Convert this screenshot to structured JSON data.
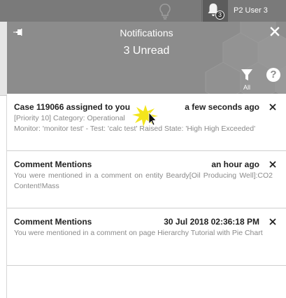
{
  "topbar": {
    "user_name": "P2 User 3",
    "notification_count": "3",
    "icons": [
      "lightbulb-icon",
      "bell-icon"
    ]
  },
  "panel": {
    "title": "Notifications",
    "unread_summary": "3 Unread",
    "filter_label": "All",
    "help_glyph": "?"
  },
  "notifications": [
    {
      "title": "Case 119066 assigned to you",
      "time": "a few seconds ago",
      "lines": [
        "[Priority 10] Category: Operational",
        "Monitor: 'monitor test' - Test: 'calc test' Raised State: 'High High Exceeded'"
      ]
    },
    {
      "title": "Comment Mentions",
      "time": "an hour ago",
      "body": "You were mentioned in a comment on entity Beardy[Oil Producing Well]:CO2 Content!Mass"
    },
    {
      "title": "Comment Mentions",
      "time": "30 Jul 2018 02:36:18 PM",
      "body": "You were mentioned in a comment on page Hierarchy Tutorial with Pie Chart"
    }
  ],
  "colors": {
    "topbar": "#7a7a7a",
    "header": "#8c8c8c",
    "bell_bg": "#5c5c5c",
    "title_text": "#222222",
    "body_text": "#8a8a8a"
  }
}
